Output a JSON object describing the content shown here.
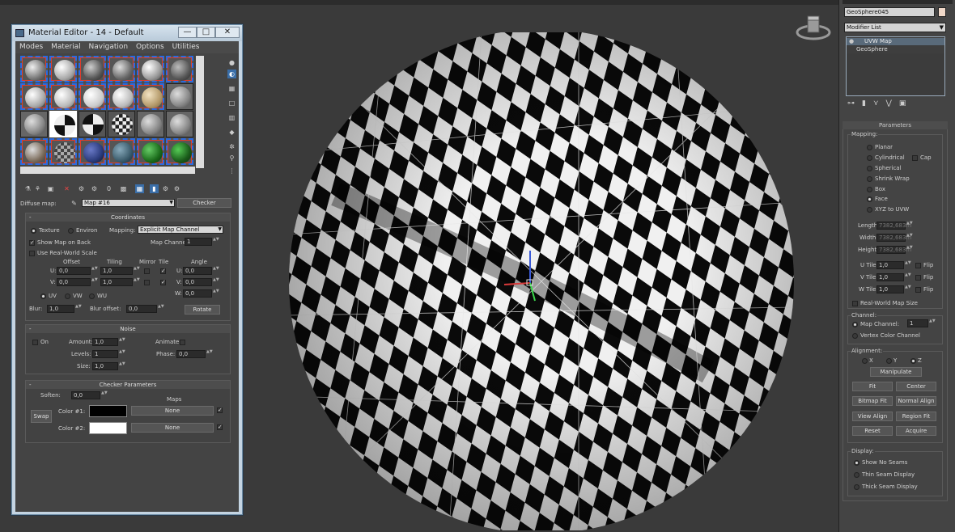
{
  "material_editor": {
    "title": "Material Editor - 14 - Default",
    "window_buttons": {
      "minimize": "—",
      "restore": "□",
      "close": "✕"
    },
    "menu": [
      "Modes",
      "Material",
      "Navigation",
      "Options",
      "Utilities"
    ],
    "diffuse_label": "Diffuse map:",
    "map_name": "Map #16",
    "map_type": "Checker",
    "coordinates": {
      "title": "Coordinates",
      "texture": "Texture",
      "environ": "Environ",
      "mapping_label": "Mapping:",
      "mapping_value": "Explicit Map Channel",
      "show_map_on_back": "Show Map on Back",
      "map_channel_label": "Map Channel:",
      "map_channel_value": "1",
      "use_real_world": "Use Real-World Scale",
      "offset": "Offset",
      "tiling": "Tiling",
      "mirror": "Mirror",
      "tile": "Tile",
      "angle": "Angle",
      "u": "U:",
      "v": "V:",
      "w": "W:",
      "u_offset": "0,0",
      "v_offset": "0,0",
      "u_tiling": "1,0",
      "v_tiling": "1,0",
      "u_angle": "0,0",
      "v_angle": "0,0",
      "w_angle": "0,0",
      "uv": "UV",
      "vw": "VW",
      "wu": "WU",
      "blur_label": "Blur:",
      "blur": "1,0",
      "blur_offset_label": "Blur offset:",
      "blur_offset": "0,0",
      "rotate": "Rotate"
    },
    "noise": {
      "title": "Noise",
      "on": "On",
      "amount_label": "Amount:",
      "amount": "1,0",
      "levels_label": "Levels:",
      "levels": "1",
      "size_label": "Size:",
      "size": "1,0",
      "animate_label": "Animate:",
      "phase_label": "Phase:",
      "phase": "0,0"
    },
    "checker": {
      "title": "Checker Parameters",
      "softenlabel": "Soften:",
      "soften": "0,0",
      "maps": "Maps",
      "swap": "Swap",
      "color1_label": "Color #1:",
      "color2_label": "Color #2:",
      "color1": "#000000",
      "color2": "#ffffff",
      "none1": "None",
      "none2": "None"
    }
  },
  "command_panel": {
    "object_name": "GeoSphere045",
    "modifier_list": "Modifier List",
    "stack": [
      "UVW Map",
      "GeoSphere"
    ],
    "parameters_title": "Parameters",
    "mapping_label": "Mapping:",
    "mapping_options": [
      "Planar",
      "Cylindrical",
      "Spherical",
      "Shrink Wrap",
      "Box",
      "Face",
      "XYZ to UVW"
    ],
    "cap": "Cap",
    "length_label": "Length:",
    "length": "7382,683m",
    "width_label": "Width:",
    "width": "7382,683m",
    "height_label": "Height:",
    "height": "7382,683m",
    "u_tile_label": "U Tile:",
    "u_tile": "1,0",
    "v_tile_label": "V Tile:",
    "v_tile": "1,0",
    "w_tile_label": "W Tile:",
    "w_tile": "1,0",
    "flip": "Flip",
    "real_world": "Real-World Map Size",
    "channel_label": "Channel:",
    "map_channel": "Map Channel:",
    "map_channel_value": "1",
    "vertex_color_channel": "Vertex Color Channel",
    "alignment_label": "Alignment:",
    "axis": [
      "X",
      "Y",
      "Z"
    ],
    "manipulate": "Manipulate",
    "fit": "Fit",
    "center": "Center",
    "bitmap_fit": "Bitmap Fit",
    "normal_align": "Normal Align",
    "view_align": "View Align",
    "region_fit": "Region Fit",
    "reset": "Reset",
    "acquire": "Acquire",
    "display_label": "Display:",
    "display_options": [
      "Show No Seams",
      "Thin Seam Display",
      "Thick Seam Display"
    ]
  }
}
